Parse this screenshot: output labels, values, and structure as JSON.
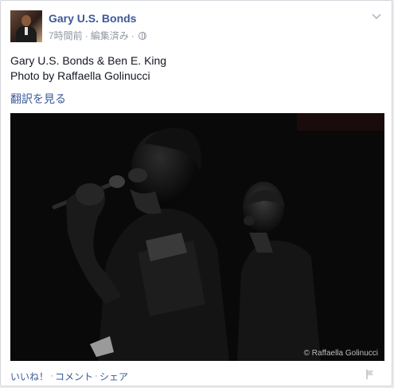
{
  "post": {
    "author": "Gary U.S. Bonds",
    "time": "7時間前",
    "edited": "編集済み",
    "separator": "·",
    "text_line1": "Gary U.S. Bonds & Ben E. King",
    "text_line2": "Photo by Raffaella Golinucci",
    "translate_label": "翻訳を見る",
    "photo_watermark": "© Raffaella Golinucci",
    "privacy_icon": "globe-icon",
    "menu_icon": "chevron-down-icon"
  },
  "actions": {
    "like_label": "いいね！",
    "comment_label": "コメント",
    "share_label": "シェア",
    "separator": "·",
    "flag_icon": "flag-icon"
  },
  "colors": {
    "link": "#3b5998",
    "meta": "#9197a3",
    "text": "#141823",
    "photo_bg": "#090909"
  }
}
